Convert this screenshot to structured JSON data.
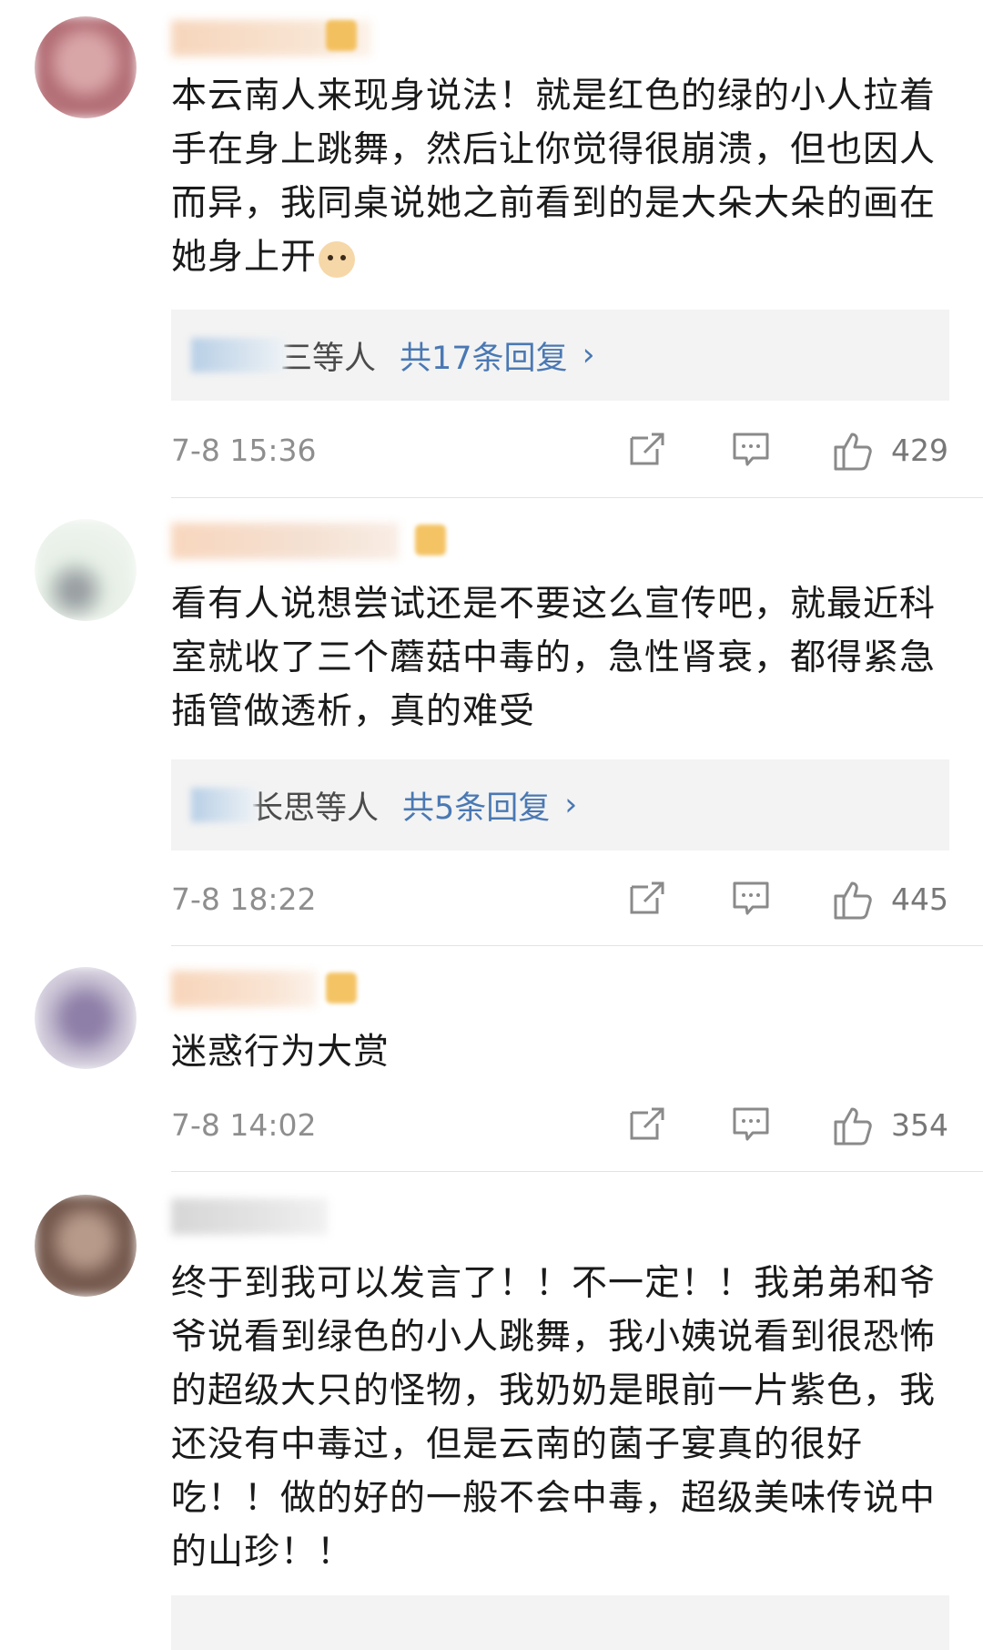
{
  "comments": [
    {
      "text": "本云南人来现身说法！就是红色的绿的小人拉着手在身上跳舞，然后让你觉得很崩溃，但也因人而异，我同桌说她之前看到的是大朵大朵的画在她身上开",
      "reply_users": "三等人",
      "reply_count": "共17条回复",
      "time": "7-8 15:36",
      "likes": "429"
    },
    {
      "text": "看有人说想尝试还是不要这么宣传吧，就最近科室就收了三个蘑菇中毒的，急性肾衰，都得紧急插管做透析，真的难受",
      "reply_users": "长思等人",
      "reply_count": "共5条回复",
      "time": "7-8 18:22",
      "likes": "445"
    },
    {
      "text": "迷惑行为大赏",
      "time": "7-8 14:02",
      "likes": "354"
    },
    {
      "text": "终于到我可以发言了！！不一定！！我弟弟和爷爷说看到绿色的小人跳舞，我小姨说看到很恐怖的超级大只的怪物，我奶奶是眼前一片紫色，我还没有中毒过，但是云南的菌子宴真的很好吃！！做的好的一般不会中毒，超级美味传说中的山珍！！"
    }
  ],
  "icons": {
    "share": "share-icon",
    "comment": "comment-icon",
    "like": "thumbs-up-icon",
    "chevron": "chevron-right-icon"
  },
  "colors": {
    "link": "#4a78b3",
    "meta": "#8e8e8e",
    "reply_bg": "#f3f3f3"
  },
  "chevron_glyph": "›"
}
